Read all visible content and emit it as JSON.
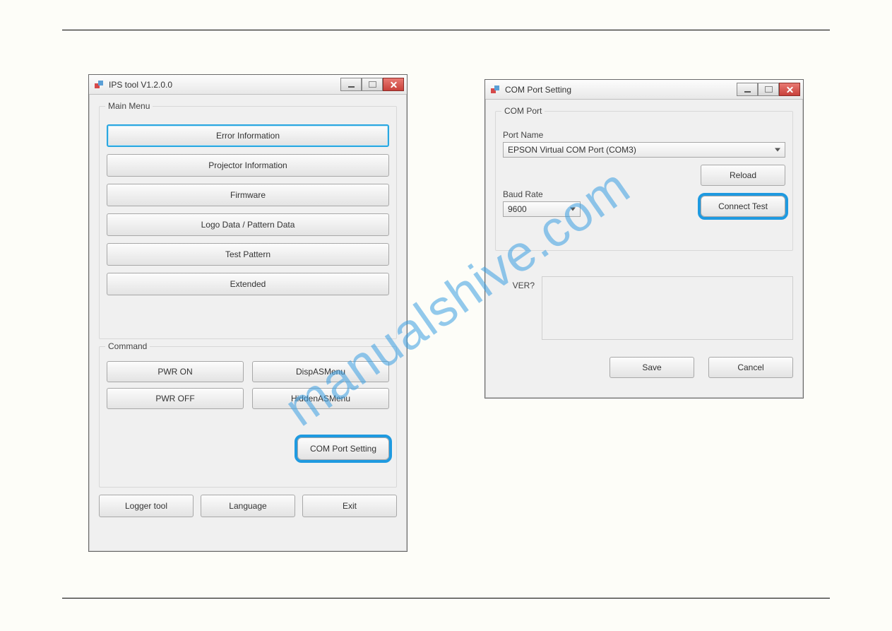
{
  "watermark": "manualshive.com",
  "main_window": {
    "title": "IPS tool V1.2.0.0",
    "main_menu": {
      "legend": "Main Menu",
      "buttons": {
        "error_info": "Error Information",
        "projector_info": "Projector Information",
        "firmware": "Firmware",
        "logo_pattern": "Logo Data / Pattern Data",
        "test_pattern": "Test Pattern",
        "extended": "Extended"
      }
    },
    "command": {
      "legend": "Command",
      "buttons": {
        "pwr_on": "PWR ON",
        "pwr_off": "PWR OFF",
        "disp_as": "DispASMenu",
        "hidden_as": "HiddenASMenu",
        "com_port": "COM Port Setting"
      }
    },
    "footer": {
      "logger": "Logger tool",
      "language": "Language",
      "exit": "Exit"
    }
  },
  "com_window": {
    "title": "COM Port Setting",
    "group_legend": "COM Port",
    "port_name_label": "Port Name",
    "port_name_value": "EPSON Virtual COM Port (COM3)",
    "baud_label": "Baud Rate",
    "baud_value": "9600",
    "reload": "Reload",
    "connect_test": "Connect Test",
    "ver_label": "VER?",
    "save": "Save",
    "cancel": "Cancel"
  }
}
